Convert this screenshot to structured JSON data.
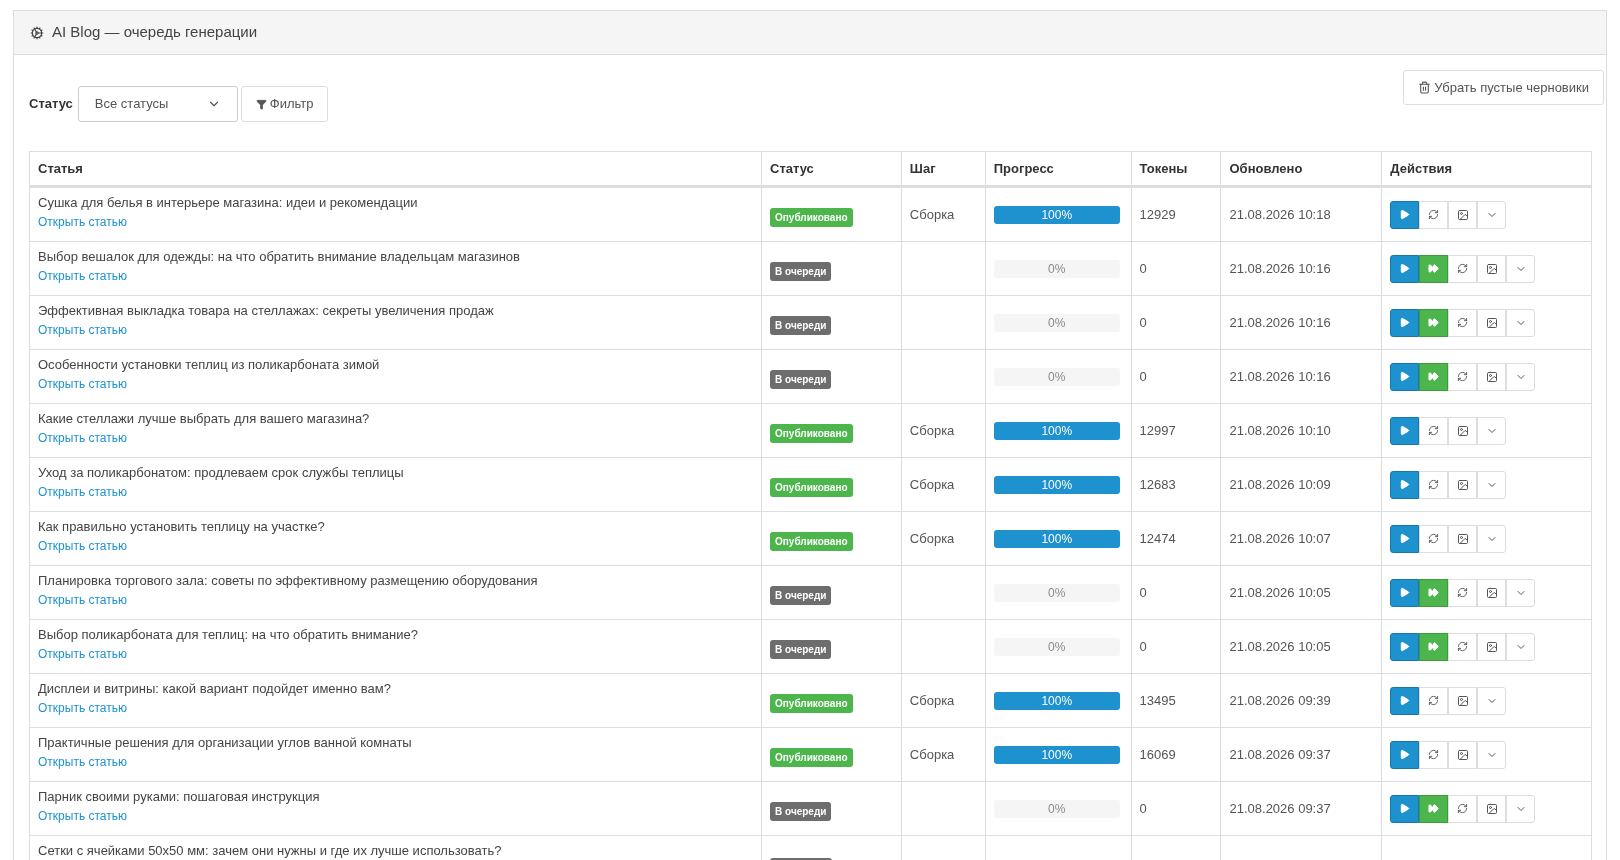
{
  "panel": {
    "title": "AI Blog — очередь генерации"
  },
  "filter": {
    "label": "Статус",
    "select_value": "Все статусы",
    "button": "Фильтр"
  },
  "cleanup_button": "Убрать пустые черновики",
  "table": {
    "columns": [
      "Статья",
      "Статус",
      "Шаг",
      "Прогресс",
      "Токены",
      "Обновлено",
      "Действия"
    ],
    "rows": [
      {
        "title": "Сушка для белья в интерьере магазина: идеи и рекомендации",
        "link": "Открыть статью",
        "status": {
          "kind": "published",
          "label": "Опубликовано"
        },
        "step": "Сборка",
        "progress": {
          "level": 1,
          "label": "100%"
        },
        "tokens": "12929",
        "updated": "21.08.2026 10:18"
      },
      {
        "title": "Выбор вешалок для одежды: на что обратить внимание владельцам магазинов",
        "link": "Открыть статью",
        "status": {
          "kind": "queued",
          "label": "В очереди"
        },
        "progress": {
          "level": 0,
          "label": "0%"
        },
        "tokens": "0",
        "updated": "21.08.2026 10:16"
      },
      {
        "title": "Эффективная выкладка товара на стеллажах: секреты увеличения продаж",
        "link": "Открыть статью",
        "status": {
          "kind": "queued",
          "label": "В очереди"
        },
        "progress": {
          "level": 0,
          "label": "0%"
        },
        "tokens": "0",
        "updated": "21.08.2026 10:16"
      },
      {
        "title": "Особенности установки теплиц из поликарбоната зимой",
        "link": "Открыть статью",
        "status": {
          "kind": "queued",
          "label": "В очереди"
        },
        "progress": {
          "level": 0,
          "label": "0%"
        },
        "tokens": "0",
        "updated": "21.08.2026 10:16"
      },
      {
        "title": "Какие стеллажи лучше выбрать для вашего магазина?",
        "link": "Открыть статью",
        "status": {
          "kind": "published",
          "label": "Опубликовано"
        },
        "step": "Сборка",
        "progress": {
          "level": 1,
          "label": "100%"
        },
        "tokens": "12997",
        "updated": "21.08.2026 10:10"
      },
      {
        "title": "Уход за поликарбонатом: продлеваем срок службы теплицы",
        "link": "Открыть статью",
        "status": {
          "kind": "published",
          "label": "Опубликовано"
        },
        "step": "Сборка",
        "progress": {
          "level": 1,
          "label": "100%"
        },
        "tokens": "12683",
        "updated": "21.08.2026 10:09"
      },
      {
        "title": "Как правильно установить теплицу на участке?",
        "link": "Открыть статью",
        "status": {
          "kind": "published",
          "label": "Опубликовано"
        },
        "step": "Сборка",
        "progress": {
          "level": 1,
          "label": "100%"
        },
        "tokens": "12474",
        "updated": "21.08.2026 10:07"
      },
      {
        "title": "Планировка торгового зала: советы по эффективному размещению оборудования",
        "link": "Открыть статью",
        "status": {
          "kind": "queued",
          "label": "В очереди"
        },
        "progress": {
          "level": 0,
          "label": "0%"
        },
        "tokens": "0",
        "updated": "21.08.2026 10:05"
      },
      {
        "title": "Выбор поликарбоната для теплиц: на что обратить внимание?",
        "link": "Открыть статью",
        "status": {
          "kind": "queued",
          "label": "В очереди"
        },
        "progress": {
          "level": 0,
          "label": "0%"
        },
        "tokens": "0",
        "updated": "21.08.2026 10:05"
      },
      {
        "title": "Дисплеи и витрины: какой вариант подойдет именно вам?",
        "link": "Открыть статью",
        "status": {
          "kind": "published",
          "label": "Опубликовано"
        },
        "step": "Сборка",
        "progress": {
          "level": 1,
          "label": "100%"
        },
        "tokens": "13495",
        "updated": "21.08.2026 09:39"
      },
      {
        "title": "Практичные решения для организации углов ванной комнаты",
        "link": "Открыть статью",
        "status": {
          "kind": "published",
          "label": "Опубликовано"
        },
        "step": "Сборка",
        "progress": {
          "level": 1,
          "label": "100%"
        },
        "tokens": "16069",
        "updated": "21.08.2026 09:37"
      },
      {
        "title": "Парник своими руками: пошаговая инструкция",
        "link": "Открыть статью",
        "status": {
          "kind": "queued",
          "label": "В очереди"
        },
        "progress": {
          "level": 0,
          "label": "0%"
        },
        "tokens": "0",
        "updated": "21.08.2026 09:37"
      },
      {
        "title": "Сетки с ячейками 50х50 мм: зачем они нужны и где их лучше использовать?",
        "status": {
          "kind": "queued"
        }
      }
    ]
  }
}
